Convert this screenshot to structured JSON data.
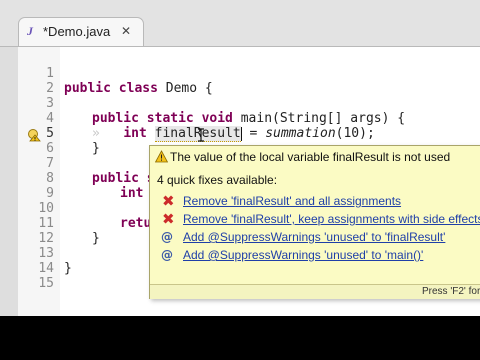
{
  "editor": {
    "tab": {
      "icon": "java-file-icon",
      "title": "*Demo.java",
      "close": "✕"
    },
    "line_numbers": [
      "1",
      "2",
      "3",
      "4",
      "5",
      "6",
      "7",
      "8",
      "9",
      "10",
      "11",
      "12",
      "13",
      "14",
      "15"
    ],
    "current_line": "5",
    "code": {
      "l2_kw": "public class",
      "l2_rest": " Demo {",
      "l4_kw": "public static void",
      "l4_rest": " main(String[] args) {",
      "l5_ws": "»   ",
      "l5_kw": "int",
      "l5_var": "finalResult",
      "l5_eq": " = ",
      "l5_call": "summation",
      "l5_rest": "(10);",
      "l6": "}",
      "l8_kw": "public s",
      "l9_kw": "int",
      "l11_kw": "retu",
      "l12": "}",
      "l14": "}"
    }
  },
  "quickfix": {
    "header": "The value of the local variable finalResult is not used",
    "count_label": "4 quick fixes available:",
    "fixes": [
      {
        "label": "Remove 'finalResult' and all assignments",
        "icon": "remove-icon"
      },
      {
        "label": "Remove 'finalResult', keep assignments with side effects",
        "icon": "remove-icon"
      },
      {
        "label": "Add @SuppressWarnings 'unused' to 'finalResult'",
        "icon": "annotation-icon"
      },
      {
        "label": "Add @SuppressWarnings 'unused' to 'main()'",
        "icon": "annotation-icon"
      }
    ],
    "footer": "Press 'F2' for"
  },
  "colors": {
    "keyword": "#7f0055",
    "popup_bg": "#fbfbc4",
    "link": "#1f3fa8",
    "remove": "#cc2b2b"
  }
}
